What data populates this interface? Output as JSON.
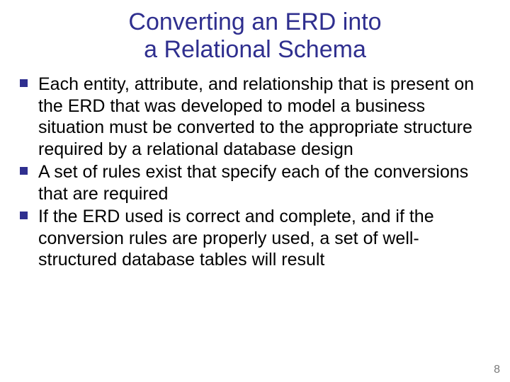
{
  "title_line1": "Converting an ERD into",
  "title_line2": "a Relational Schema",
  "bullets": [
    "Each entity, attribute, and relationship that is present on the ERD that was developed to model a business situation must be converted to the appropriate structure required by a relational database design",
    "A set of rules exist that specify each of the conversions that are required",
    "If the ERD used is correct and complete, and if the conversion rules are properly used, a set of well-structured database tables will result"
  ],
  "page_number": "8"
}
